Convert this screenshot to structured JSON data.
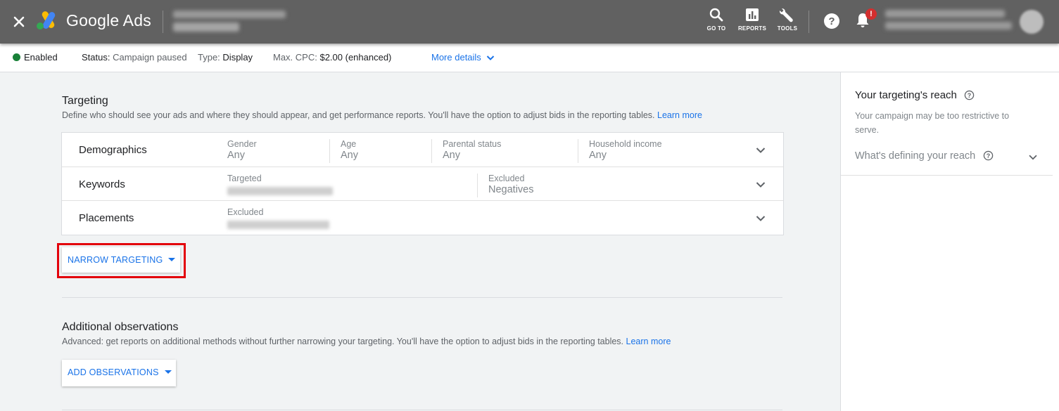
{
  "header": {
    "app_name": "Google Ads",
    "tools": [
      {
        "label": "GO TO",
        "icon": "search-icon"
      },
      {
        "label": "REPORTS",
        "icon": "bar-chart-icon"
      },
      {
        "label": "TOOLS",
        "icon": "wrench-icon"
      }
    ],
    "notification_badge": "!"
  },
  "status_bar": {
    "enabled": "Enabled",
    "status_label": "Status:",
    "status_value": "Campaign paused",
    "type_label": "Type:",
    "type_value": "Display",
    "cpc_label": "Max. CPC:",
    "cpc_value": "$2.00 (enhanced)",
    "more_details": "More details"
  },
  "targeting": {
    "title": "Targeting",
    "description": "Define who should see your ads and where they should appear, and get performance reports. You'll have the option to adjust bids in the reporting tables.",
    "learn_more": "Learn more",
    "rows": {
      "demographics": {
        "name": "Demographics",
        "gender_label": "Gender",
        "gender_value": "Any",
        "age_label": "Age",
        "age_value": "Any",
        "parental_label": "Parental status",
        "parental_value": "Any",
        "income_label": "Household income",
        "income_value": "Any"
      },
      "keywords": {
        "name": "Keywords",
        "targeted_label": "Targeted",
        "excluded_label": "Excluded",
        "excluded_value": "Negatives"
      },
      "placements": {
        "name": "Placements",
        "excluded_label": "Excluded"
      }
    },
    "narrow_button": "NARROW TARGETING"
  },
  "observations": {
    "title": "Additional observations",
    "description": "Advanced: get reports on additional methods without further narrowing your targeting. You'll have the option to adjust bids in the reporting tables.",
    "learn_more": "Learn more",
    "add_button": "ADD OBSERVATIONS"
  },
  "reach_panel": {
    "title": "Your targeting's reach",
    "description": "Your campaign may be too restrictive to serve.",
    "expand_label": "What's defining your reach"
  },
  "colors": {
    "topbar": "#616161",
    "link": "#1a73e8",
    "enabled_dot": "#188038",
    "highlight": "#e3000b"
  }
}
